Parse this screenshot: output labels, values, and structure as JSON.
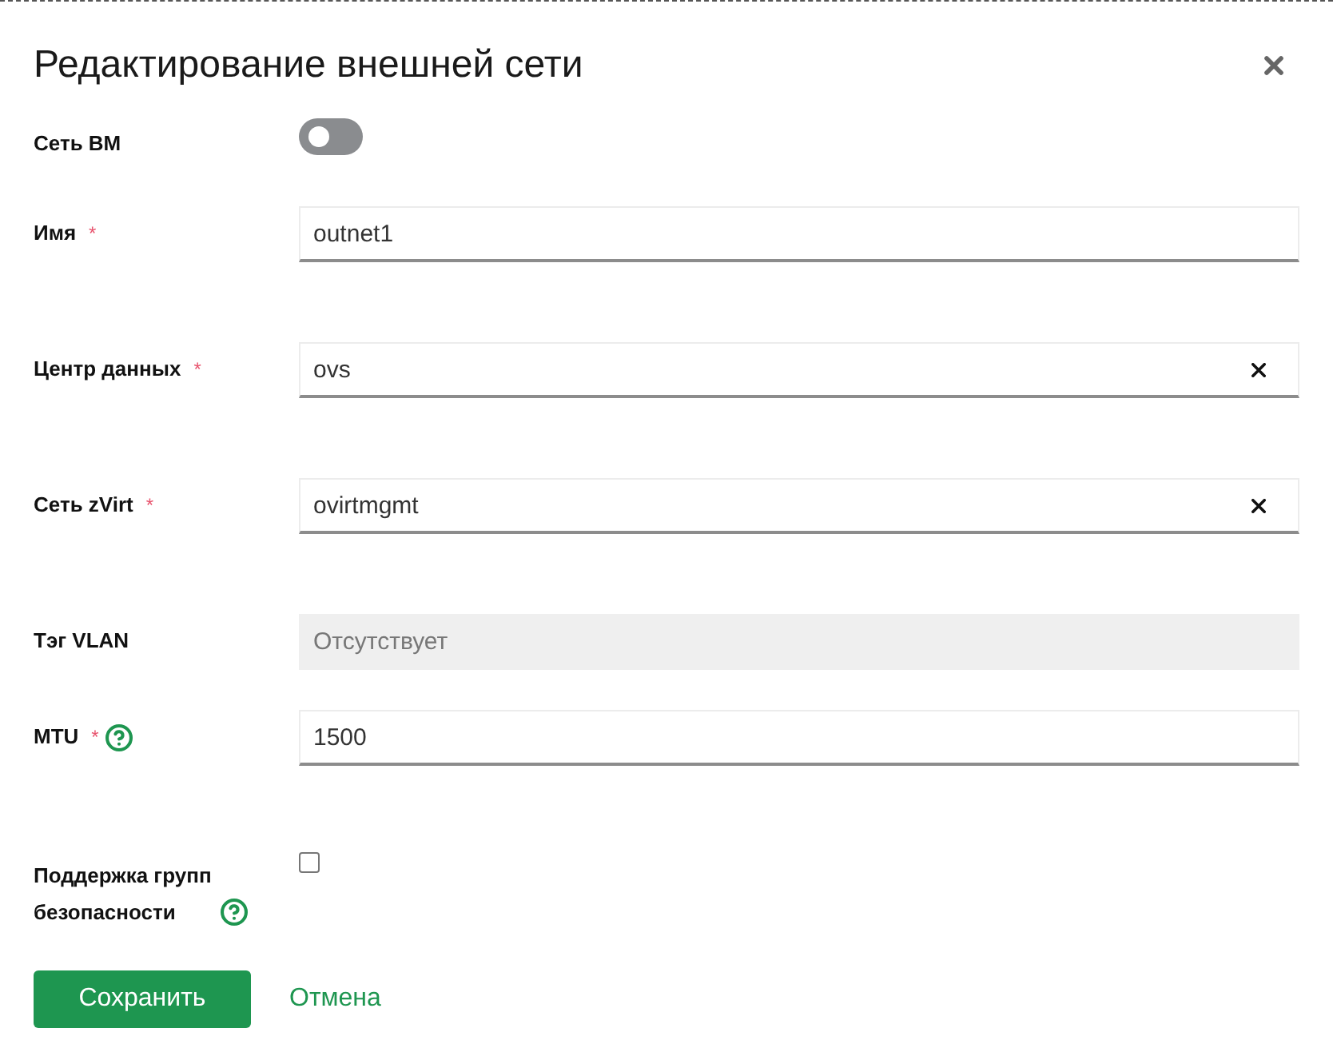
{
  "dialog": {
    "title": "Редактирование внешней сети"
  },
  "fields": [
    {
      "kind": "toggle",
      "label": "Сеть ВМ",
      "on": false
    },
    {
      "kind": "text",
      "label": "Имя",
      "required_mark": "*",
      "value": "outnet1"
    },
    {
      "kind": "select",
      "label": "Центр данных",
      "required_mark": "*",
      "value": "ovs",
      "clearable": true
    },
    {
      "kind": "select",
      "label": "Сеть zVirt",
      "required_mark": "*",
      "value": "ovirtmgmt",
      "clearable": true
    },
    {
      "kind": "text",
      "label": "Тэг VLAN",
      "disabled": true,
      "placeholder": "Отсутствует"
    },
    {
      "kind": "text",
      "label": "MTU",
      "required_mark": "*",
      "help": true,
      "value": "1500"
    },
    {
      "kind": "checkbox",
      "label": "Поддержка групп безопасности",
      "help": true,
      "checked": false
    }
  ],
  "actions": {
    "save": "Сохранить",
    "cancel": "Отмена"
  }
}
